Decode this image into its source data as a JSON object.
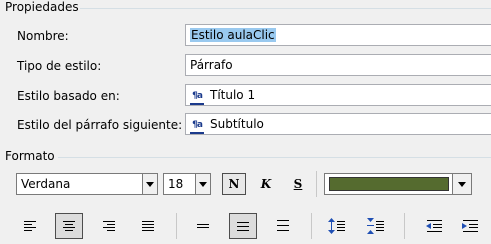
{
  "properties": {
    "title": "Propiedades",
    "name_label": "Nombre:",
    "name_value": "Estilo aulaClic",
    "style_type_label": "Tipo de estilo:",
    "style_type_value": "Párrafo",
    "based_on_label": "Estilo basado en:",
    "based_on_value": "Título 1",
    "next_style_label": "Estilo del párrafo siguiente:",
    "next_style_value": "Subtítulo"
  },
  "format": {
    "title": "Formato",
    "font_name": "Verdana",
    "font_size": "18",
    "bold_label": "N",
    "italic_label": "K",
    "underline_label": "S",
    "font_color": "#556b2f",
    "bold_active": true
  },
  "paragraph_tools": {
    "alignment": [
      "align-left",
      "align-center",
      "align-right",
      "justify"
    ],
    "selected_alignment": "align-center",
    "line_spacing": [
      "single-spacing",
      "one-and-half-spacing",
      "double-spacing"
    ],
    "selected_spacing": "one-and-half-spacing",
    "paragraph_spacing": [
      "increase-paragraph-spacing",
      "decrease-paragraph-spacing"
    ],
    "indent": [
      "decrease-indent",
      "increase-indent"
    ]
  }
}
